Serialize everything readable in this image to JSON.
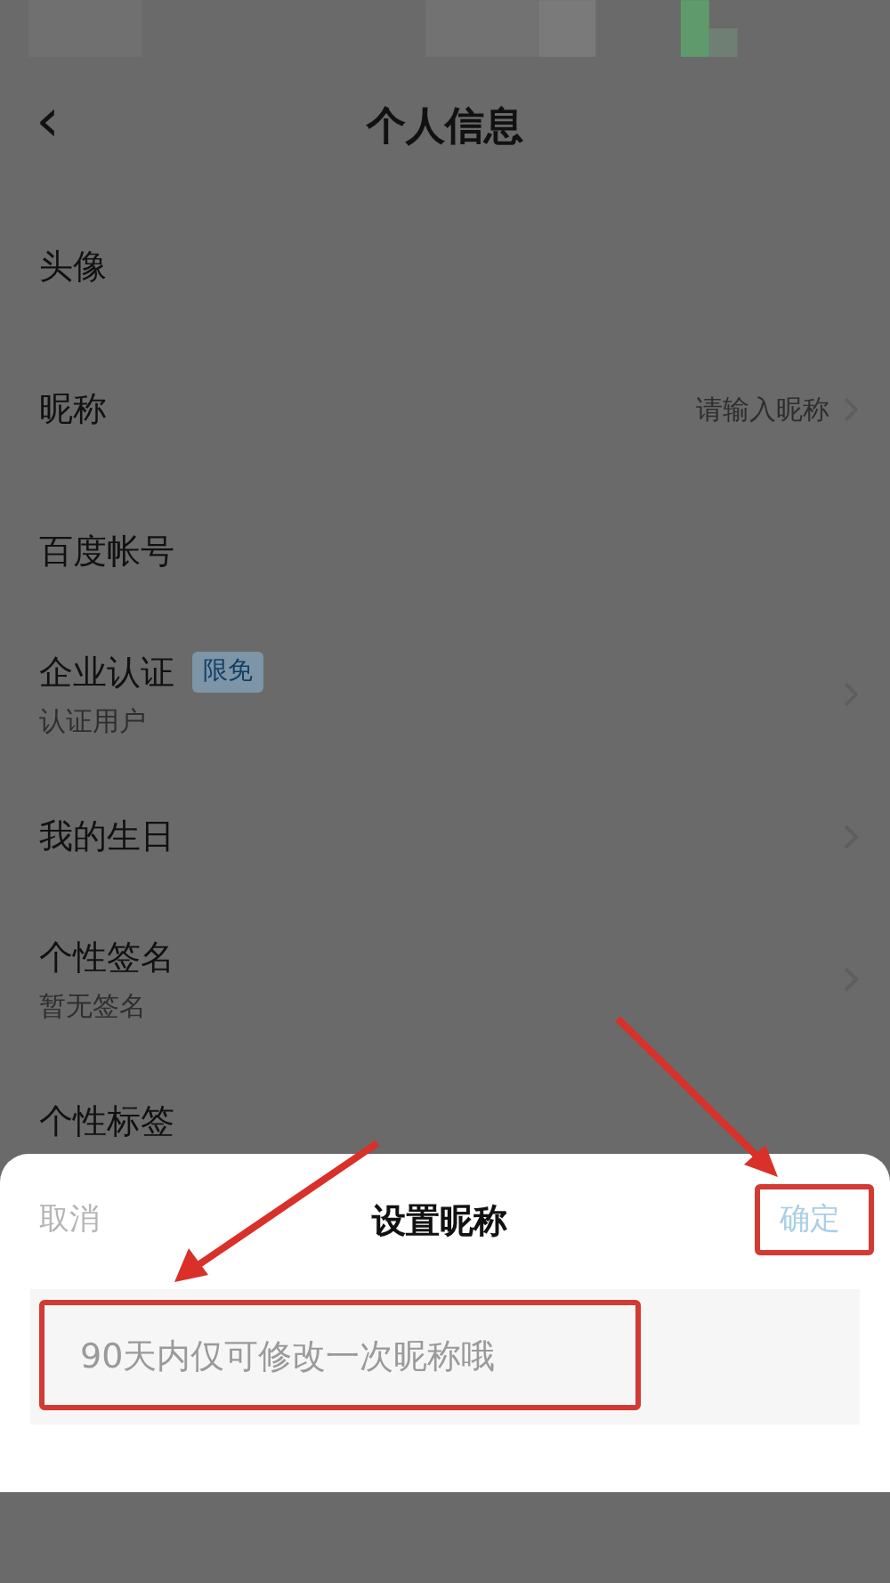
{
  "nav": {
    "back": "‹",
    "title": "个人信息"
  },
  "rows": [
    {
      "label": "头像",
      "chevron": false
    },
    {
      "label": "昵称",
      "value": "请输入昵称",
      "chevron": true
    },
    {
      "label": "百度帐号",
      "chevron": false
    },
    {
      "label": "企业认证",
      "badge": "限免",
      "sub": "认证用户",
      "chevron": true
    },
    {
      "label": "我的生日",
      "chevron": true
    },
    {
      "label": "个性签名",
      "sub": "暂无签名",
      "chevron": true
    },
    {
      "label": "个性标签",
      "chevron": false
    }
  ],
  "sheet": {
    "cancel": "取消",
    "title": "设置昵称",
    "confirm": "确定",
    "input": {
      "placeholder": "90天内仅可修改一次昵称哦"
    }
  }
}
